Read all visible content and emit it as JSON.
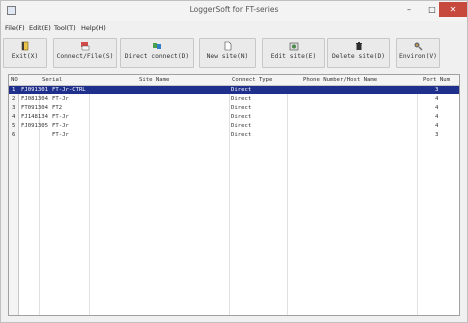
{
  "window": {
    "title": "LoggerSoft for FT-series"
  },
  "menu": [
    "File(F)",
    "Edit(E)",
    "Tool(T)",
    "Help(H)"
  ],
  "toolbar": [
    {
      "label": "Exit(X)",
      "icon": "exit-icon"
    },
    {
      "label": "Connect/File(S)",
      "icon": "file-icon"
    },
    {
      "label": "Direct connect(D)",
      "icon": "direct-connect-icon"
    },
    {
      "label": "New site(N)",
      "icon": "new-site-icon"
    },
    {
      "label": "Edit site(E)",
      "icon": "edit-site-icon"
    },
    {
      "label": "Delete site(D)",
      "icon": "delete-site-icon"
    },
    {
      "label": "Environ(V)",
      "icon": "environ-icon"
    }
  ],
  "table": {
    "columns": [
      "NO",
      "Serial",
      "Site Name",
      "Connect Type",
      "Phone Number/Host Name",
      "Port Num"
    ],
    "rows": [
      {
        "no": "1",
        "serial": "FJ091301",
        "site": "FT-Jr-CTRL",
        "type": "Direct",
        "phone": "",
        "port": "3",
        "selected": true
      },
      {
        "no": "2",
        "serial": "FJ081304",
        "site": "FT-Jr",
        "type": "Direct",
        "phone": "",
        "port": "4",
        "selected": false
      },
      {
        "no": "3",
        "serial": "FT091304",
        "site": "FT2",
        "type": "Direct",
        "phone": "",
        "port": "4",
        "selected": false
      },
      {
        "no": "4",
        "serial": "FJ148134",
        "site": "FT-Jr",
        "type": "Direct",
        "phone": "",
        "port": "4",
        "selected": false
      },
      {
        "no": "5",
        "serial": "FJ091305",
        "site": "FT-Jr",
        "type": "Direct",
        "phone": "",
        "port": "4",
        "selected": false
      },
      {
        "no": "6",
        "serial": "",
        "site": "FT-Jr",
        "type": "Direct",
        "phone": "",
        "port": "3",
        "selected": false
      }
    ]
  },
  "colors": {
    "selection": "#1f2f8c",
    "close": "#c7483d"
  }
}
